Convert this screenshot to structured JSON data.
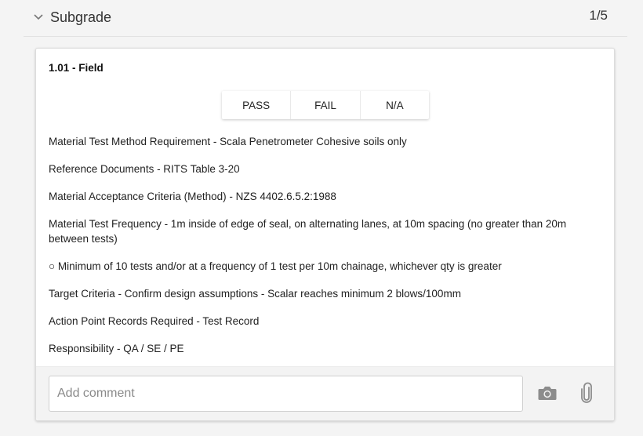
{
  "section": {
    "title": "Subgrade",
    "count": "1/5"
  },
  "card": {
    "title": "1.01 - Field",
    "buttons": {
      "pass": "PASS",
      "fail": "FAIL",
      "na": "N/A"
    },
    "lines": [
      "Material Test Method Requirement - Scala Penetrometer Cohesive soils only",
      "Reference Documents - RITS Table 3-20",
      "Material Acceptance Criteria (Method) - NZS 4402.6.5.2:1988",
      "Material Test Frequency - 1m inside of edge of seal, on alternating lanes, at 10m spacing (no greater than 20m between tests)",
      "○ Minimum of 10 tests and/or at a frequency of 1 test per 10m chainage, whichever qty is greater",
      "Target Criteria - Confirm design assumptions - Scalar reaches minimum 2 blows/100mm",
      "Action Point Records Required - Test Record",
      "Responsibility - QA / SE / PE"
    ],
    "comment": {
      "placeholder": "Add comment",
      "value": ""
    },
    "icons": {
      "camera": "camera-icon",
      "attach": "paperclip-icon"
    }
  },
  "colors": {
    "icon": "#8c8c8c",
    "background": "#f4f4f4"
  }
}
